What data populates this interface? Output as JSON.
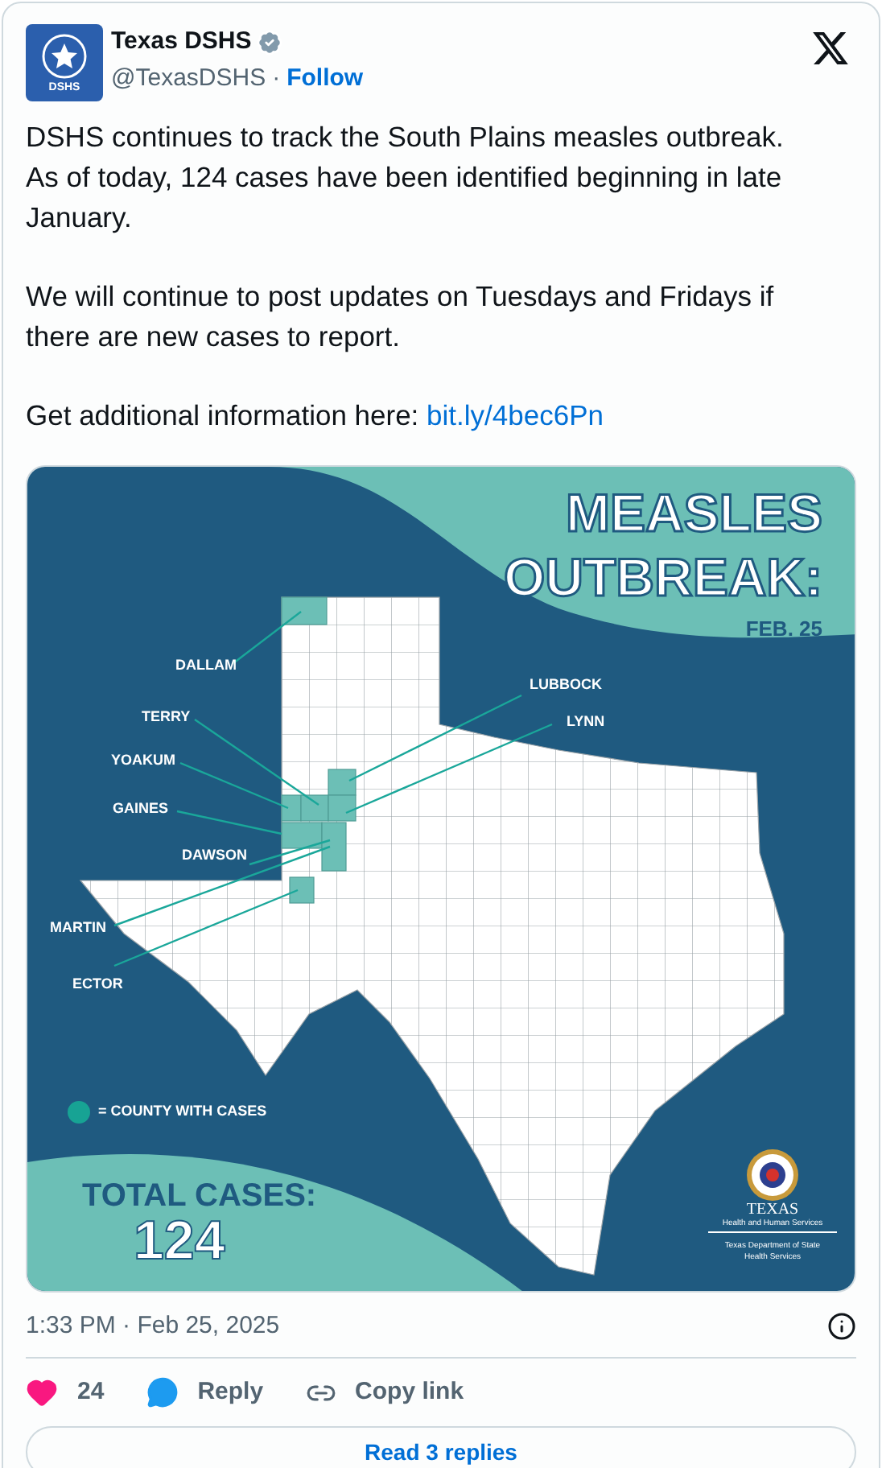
{
  "author": {
    "name": "Texas DSHS",
    "handle": "@TexasDSHS",
    "separator": "·",
    "follow": "Follow",
    "avatar_text": "DSHS",
    "verified": true
  },
  "tweet": {
    "paragraphs": [
      {
        "text": "DSHS continues to track the South Plains measles outbreak. As of today, 124 cases have been identified beginning in late January."
      },
      {
        "text": "We will continue to post updates on Tuesdays and Fridays if there are new cases to report."
      },
      {
        "text": "Get additional information here: ",
        "link": "bit.ly/4bec6Pn"
      }
    ]
  },
  "infographic": {
    "title_lines": [
      "MEASLES",
      "OUTBREAK:"
    ],
    "date": "FEB. 25",
    "counties": [
      {
        "name": "DALLAM"
      },
      {
        "name": "TERRY"
      },
      {
        "name": "YOAKUM"
      },
      {
        "name": "GAINES"
      },
      {
        "name": "DAWSON"
      },
      {
        "name": "MARTIN"
      },
      {
        "name": "ECTOR"
      },
      {
        "name": "LUBBOCK"
      },
      {
        "name": "LYNN"
      }
    ],
    "legend": "= COUNTY WITH CASES",
    "total_label": "TOTAL CASES:",
    "total_value": "124",
    "logo": {
      "name": "TEXAS",
      "line_1": "Health and Human Services",
      "line_2": "Texas Department of State",
      "line_3": "Health Services"
    }
  },
  "timestamp": "1:33 PM · Feb 25, 2025",
  "actions": [
    {
      "kind": "like",
      "label": "24"
    },
    {
      "kind": "reply",
      "label": "Reply"
    },
    {
      "kind": "copy",
      "label": "Copy link"
    }
  ],
  "read_replies": "Read 3 replies"
}
